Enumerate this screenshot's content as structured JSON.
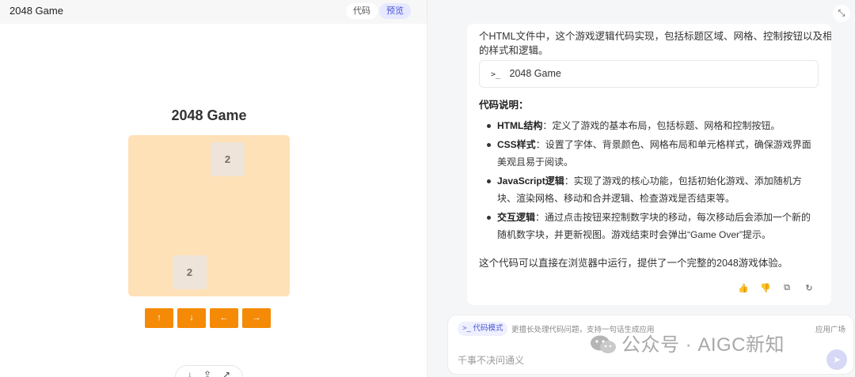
{
  "left": {
    "app_title": "2048 Game",
    "tabs": [
      {
        "label": "代码"
      },
      {
        "label": "预览"
      }
    ],
    "active_tab": "预览",
    "game": {
      "title": "2048 Game",
      "tiles": [
        {
          "value": "2"
        },
        {
          "value": "2"
        }
      ],
      "controls": [
        {
          "label": "↑",
          "icon": "arrow-up-icon"
        },
        {
          "label": "↓",
          "icon": "arrow-down-icon"
        },
        {
          "label": "←",
          "icon": "arrow-left-icon"
        },
        {
          "label": "→",
          "icon": "arrow-right-icon"
        }
      ]
    },
    "float_toolbar": {
      "icons": [
        "download-icon",
        "share-icon",
        "open-external-icon"
      ],
      "glyphs": [
        "↓",
        "⇪",
        "↗"
      ]
    }
  },
  "right": {
    "collapse_glyph": "⤡",
    "message": {
      "cut_line": "个HTML文件中，这个游戏逻辑代码实现，包括标题区域、网格、控制按钮以及相应",
      "line2": "的样式和逻辑。",
      "file_card": {
        "prompt": ">_",
        "name": "2048 Game"
      },
      "section_title": "代码说明：",
      "bullets": [
        {
          "bold": "HTML结构",
          "text": "：定义了游戏的基本布局，包括标题、网格和控制按钮。"
        },
        {
          "bold": "CSS样式",
          "text": "：设置了字体、背景颜色、网格布局和单元格样式，确保游戏界面美观且易于阅读。"
        },
        {
          "bold": "JavaScript逻辑",
          "text": "：实现了游戏的核心功能，包括初始化游戏、添加随机方块、渲染网格、移动和合并逻辑、检查游戏是否结束等。"
        },
        {
          "bold": "交互逻辑",
          "text": "：通过点击按钮来控制数字块的移动，每次移动后会添加一个新的随机数字块，并更新视图。游戏结束时会弹出“Game Over”提示。"
        }
      ],
      "summary": "这个代码可以直接在浏览器中运行，提供了一个完整的2048游戏体验。",
      "actions": [
        {
          "icon": "thumbs-up-icon",
          "glyph": "👍"
        },
        {
          "icon": "thumbs-down-icon",
          "glyph": "👎"
        },
        {
          "icon": "copy-icon",
          "glyph": "⧉"
        },
        {
          "icon": "regenerate-icon",
          "glyph": "↻"
        }
      ]
    },
    "composer": {
      "mode_chip": ">_ 代码模式",
      "mode_desc": "更擅长处理代码问题，支持一句话生成应用",
      "app_plaza": "应用广场",
      "placeholder": "千事不决问通义",
      "send_glyph": "➤"
    }
  },
  "watermark": "公众号 · AIGC新知",
  "colors": {
    "board": "#ffe1b7",
    "tile": "#eee4da",
    "button": "#f58a07",
    "accent": "#4b57d6"
  }
}
